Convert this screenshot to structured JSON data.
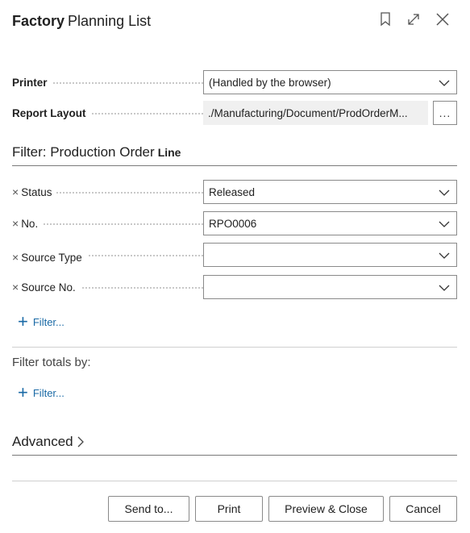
{
  "dialog": {
    "title_part1": "Factory",
    "title_part2": "Planning List"
  },
  "options": {
    "printer_label": "Printer",
    "printer_value": "(Handled by the browser)",
    "report_layout_label": "Report Layout",
    "report_layout_value": "./Manufacturing/Document/ProdOrderM...",
    "ellipsis_label": "..."
  },
  "filter_section": {
    "heading_main": "Filter: Production Order",
    "heading_small": "Line",
    "remove_icon": "×",
    "fields": [
      {
        "label": "Status",
        "value": "Released"
      },
      {
        "label": "No.",
        "value": "RPO0006"
      },
      {
        "label": "Source Type",
        "value": ""
      },
      {
        "label": "Source No.",
        "value": ""
      }
    ],
    "add_filter_label": "Filter..."
  },
  "totals_section": {
    "heading": "Filter totals by:",
    "add_filter_label": "Filter..."
  },
  "advanced": {
    "label": "Advanced"
  },
  "footer": {
    "send_to_label": "Send to...",
    "print_label": "Print",
    "preview_close_label": "Preview & Close",
    "cancel_label": "Cancel"
  },
  "icons": {
    "bookmark": "bookmark-icon",
    "expand": "expand-icon",
    "close": "close-icon",
    "chevron_down": "chevron-down-icon",
    "chevron_right": "chevron-right-icon",
    "plus": "plus-icon",
    "remove": "remove-filter-icon"
  }
}
